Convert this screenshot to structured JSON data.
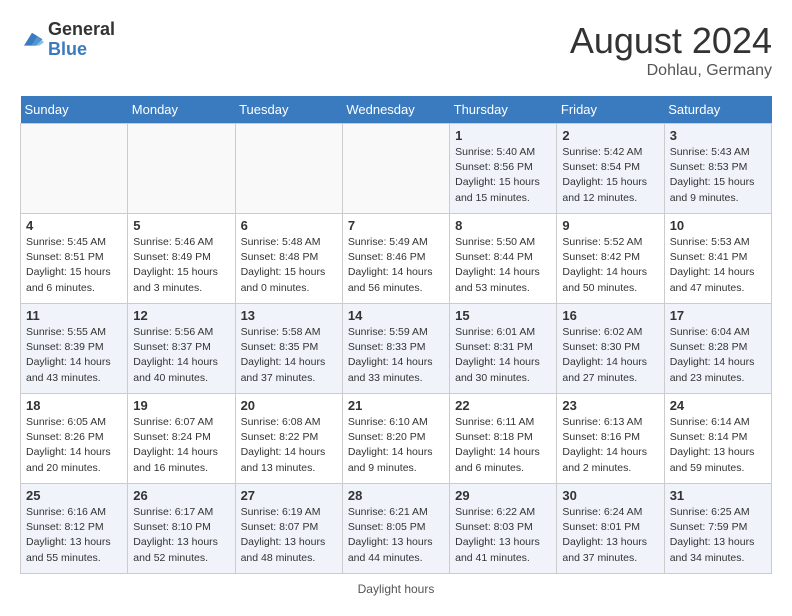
{
  "header": {
    "logo_general": "General",
    "logo_blue": "Blue",
    "month_year": "August 2024",
    "location": "Dohlau, Germany"
  },
  "footer": {
    "note": "Daylight hours"
  },
  "days_of_week": [
    "Sunday",
    "Monday",
    "Tuesday",
    "Wednesday",
    "Thursday",
    "Friday",
    "Saturday"
  ],
  "weeks": [
    [
      {
        "day": "",
        "info": ""
      },
      {
        "day": "",
        "info": ""
      },
      {
        "day": "",
        "info": ""
      },
      {
        "day": "",
        "info": ""
      },
      {
        "day": "1",
        "info": "Sunrise: 5:40 AM\nSunset: 8:56 PM\nDaylight: 15 hours and 15 minutes."
      },
      {
        "day": "2",
        "info": "Sunrise: 5:42 AM\nSunset: 8:54 PM\nDaylight: 15 hours and 12 minutes."
      },
      {
        "day": "3",
        "info": "Sunrise: 5:43 AM\nSunset: 8:53 PM\nDaylight: 15 hours and 9 minutes."
      }
    ],
    [
      {
        "day": "4",
        "info": "Sunrise: 5:45 AM\nSunset: 8:51 PM\nDaylight: 15 hours and 6 minutes."
      },
      {
        "day": "5",
        "info": "Sunrise: 5:46 AM\nSunset: 8:49 PM\nDaylight: 15 hours and 3 minutes."
      },
      {
        "day": "6",
        "info": "Sunrise: 5:48 AM\nSunset: 8:48 PM\nDaylight: 15 hours and 0 minutes."
      },
      {
        "day": "7",
        "info": "Sunrise: 5:49 AM\nSunset: 8:46 PM\nDaylight: 14 hours and 56 minutes."
      },
      {
        "day": "8",
        "info": "Sunrise: 5:50 AM\nSunset: 8:44 PM\nDaylight: 14 hours and 53 minutes."
      },
      {
        "day": "9",
        "info": "Sunrise: 5:52 AM\nSunset: 8:42 PM\nDaylight: 14 hours and 50 minutes."
      },
      {
        "day": "10",
        "info": "Sunrise: 5:53 AM\nSunset: 8:41 PM\nDaylight: 14 hours and 47 minutes."
      }
    ],
    [
      {
        "day": "11",
        "info": "Sunrise: 5:55 AM\nSunset: 8:39 PM\nDaylight: 14 hours and 43 minutes."
      },
      {
        "day": "12",
        "info": "Sunrise: 5:56 AM\nSunset: 8:37 PM\nDaylight: 14 hours and 40 minutes."
      },
      {
        "day": "13",
        "info": "Sunrise: 5:58 AM\nSunset: 8:35 PM\nDaylight: 14 hours and 37 minutes."
      },
      {
        "day": "14",
        "info": "Sunrise: 5:59 AM\nSunset: 8:33 PM\nDaylight: 14 hours and 33 minutes."
      },
      {
        "day": "15",
        "info": "Sunrise: 6:01 AM\nSunset: 8:31 PM\nDaylight: 14 hours and 30 minutes."
      },
      {
        "day": "16",
        "info": "Sunrise: 6:02 AM\nSunset: 8:30 PM\nDaylight: 14 hours and 27 minutes."
      },
      {
        "day": "17",
        "info": "Sunrise: 6:04 AM\nSunset: 8:28 PM\nDaylight: 14 hours and 23 minutes."
      }
    ],
    [
      {
        "day": "18",
        "info": "Sunrise: 6:05 AM\nSunset: 8:26 PM\nDaylight: 14 hours and 20 minutes."
      },
      {
        "day": "19",
        "info": "Sunrise: 6:07 AM\nSunset: 8:24 PM\nDaylight: 14 hours and 16 minutes."
      },
      {
        "day": "20",
        "info": "Sunrise: 6:08 AM\nSunset: 8:22 PM\nDaylight: 14 hours and 13 minutes."
      },
      {
        "day": "21",
        "info": "Sunrise: 6:10 AM\nSunset: 8:20 PM\nDaylight: 14 hours and 9 minutes."
      },
      {
        "day": "22",
        "info": "Sunrise: 6:11 AM\nSunset: 8:18 PM\nDaylight: 14 hours and 6 minutes."
      },
      {
        "day": "23",
        "info": "Sunrise: 6:13 AM\nSunset: 8:16 PM\nDaylight: 14 hours and 2 minutes."
      },
      {
        "day": "24",
        "info": "Sunrise: 6:14 AM\nSunset: 8:14 PM\nDaylight: 13 hours and 59 minutes."
      }
    ],
    [
      {
        "day": "25",
        "info": "Sunrise: 6:16 AM\nSunset: 8:12 PM\nDaylight: 13 hours and 55 minutes."
      },
      {
        "day": "26",
        "info": "Sunrise: 6:17 AM\nSunset: 8:10 PM\nDaylight: 13 hours and 52 minutes."
      },
      {
        "day": "27",
        "info": "Sunrise: 6:19 AM\nSunset: 8:07 PM\nDaylight: 13 hours and 48 minutes."
      },
      {
        "day": "28",
        "info": "Sunrise: 6:21 AM\nSunset: 8:05 PM\nDaylight: 13 hours and 44 minutes."
      },
      {
        "day": "29",
        "info": "Sunrise: 6:22 AM\nSunset: 8:03 PM\nDaylight: 13 hours and 41 minutes."
      },
      {
        "day": "30",
        "info": "Sunrise: 6:24 AM\nSunset: 8:01 PM\nDaylight: 13 hours and 37 minutes."
      },
      {
        "day": "31",
        "info": "Sunrise: 6:25 AM\nSunset: 7:59 PM\nDaylight: 13 hours and 34 minutes."
      }
    ]
  ]
}
